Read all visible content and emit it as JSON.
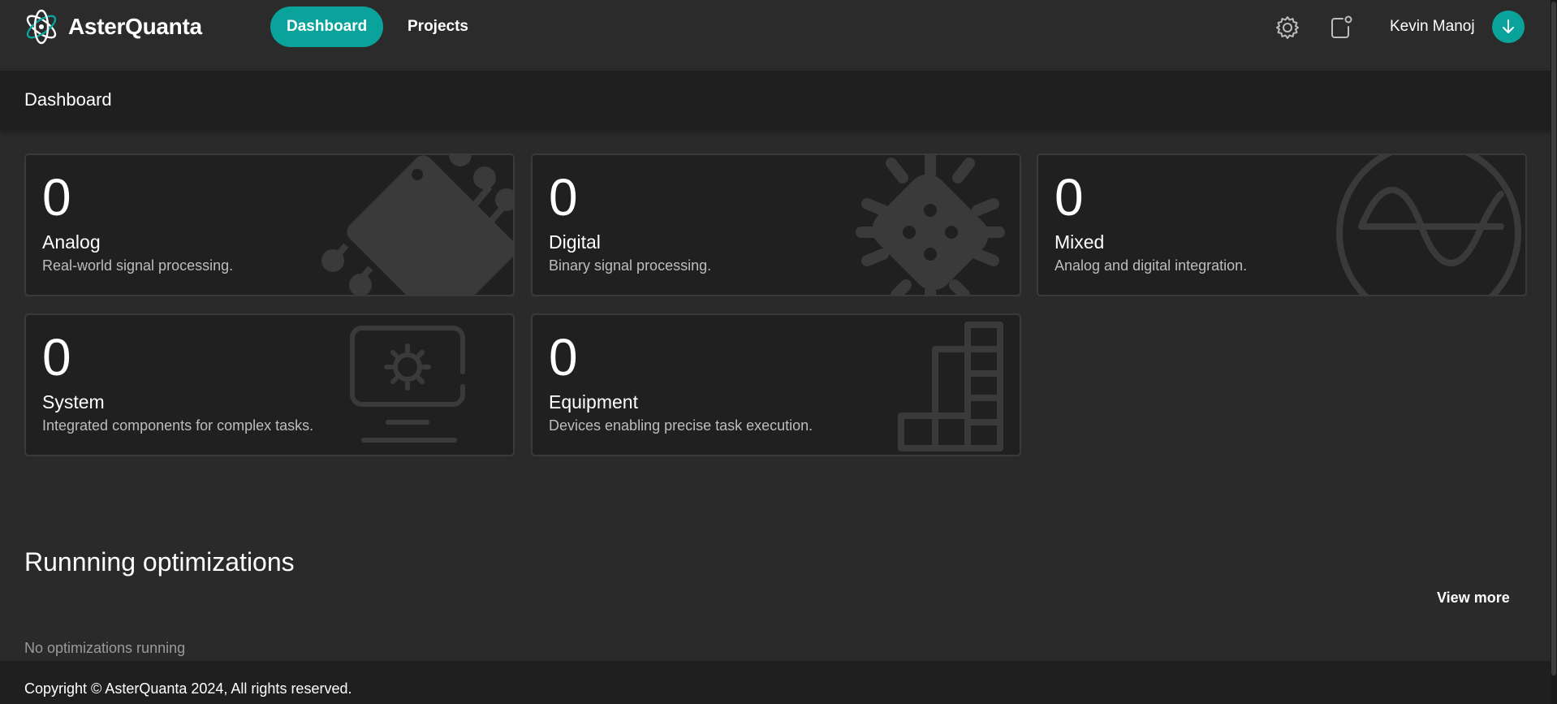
{
  "app": {
    "name": "AsterQuanta"
  },
  "nav": {
    "dashboard": "Dashboard",
    "projects": "Projects"
  },
  "user": {
    "name": "Kevin Manoj"
  },
  "page": {
    "title": "Dashboard"
  },
  "cards": [
    {
      "count": "0",
      "title": "Analog",
      "description": "Real-world signal processing.",
      "icon": "chip-icon"
    },
    {
      "count": "0",
      "title": "Digital",
      "description": "Binary signal processing.",
      "icon": "processor-icon"
    },
    {
      "count": "0",
      "title": "Mixed",
      "description": "Analog and digital integration.",
      "icon": "sine-wave-icon"
    },
    {
      "count": "0",
      "title": "System",
      "description": "Integrated components for complex tasks.",
      "icon": "monitor-settings-icon"
    },
    {
      "count": "0",
      "title": "Equipment",
      "description": "Devices enabling precise task execution.",
      "icon": "blocks-icon"
    }
  ],
  "optimizations": {
    "title": "Runnning optimizations",
    "view_more": "View more",
    "empty": "No optimizations running"
  },
  "footer": {
    "copyright": "Copyright © AsterQuanta 2024, All rights reserved."
  },
  "colors": {
    "accent": "#0aa39b",
    "background": "#2a2a2a",
    "card": "#202020"
  }
}
